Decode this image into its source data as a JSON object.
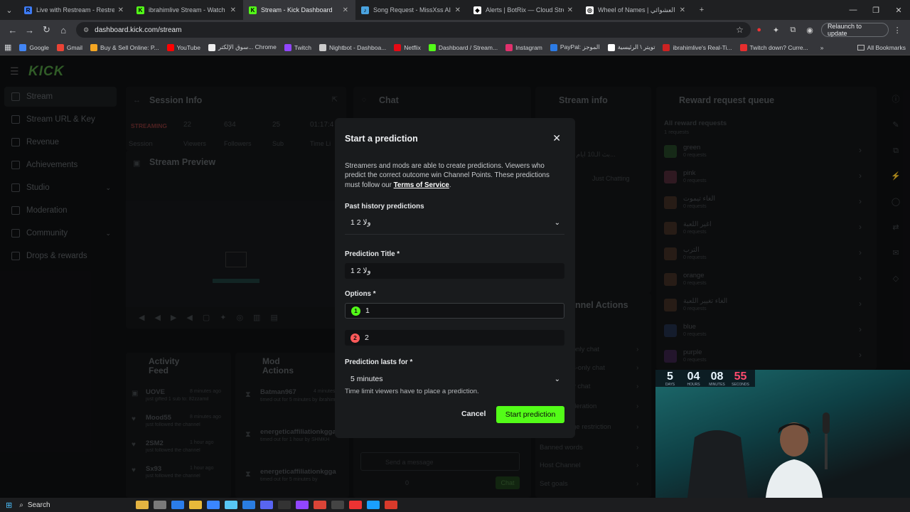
{
  "browser": {
    "tabs": [
      {
        "label": "Live with Restream - Restream",
        "color": "#3d7bf5",
        "glyph": "R"
      },
      {
        "label": "ibrahimlive Stream - Watch Live",
        "color": "#53fc18",
        "glyph": "K"
      },
      {
        "label": "Stream - Kick Dashboard",
        "color": "#53fc18",
        "glyph": "K"
      },
      {
        "label": "Song Request - MissXss AI Bot",
        "color": "#4aa3df",
        "glyph": "♪"
      },
      {
        "label": "Alerts | BotRix — Cloud Stream",
        "color": "#ffffff",
        "glyph": "◆"
      },
      {
        "label": "Wheel of Names | اسم العشوائي",
        "color": "#ffffff",
        "glyph": "◎"
      }
    ],
    "url": "dashboard.kick.com/stream",
    "relaunch_label": "Relaunch to update",
    "bookmarks": [
      {
        "label": "Google",
        "color": "#4285f4"
      },
      {
        "label": "Gmail",
        "color": "#ea4335"
      },
      {
        "label": "Buy & Sell Online: P...",
        "color": "#f5a623"
      },
      {
        "label": "YouTube",
        "color": "#ff0000"
      },
      {
        "label": "سوق الإلكتر... Chrome",
        "color": "#eeeeee"
      },
      {
        "label": "Twitch",
        "color": "#9146ff"
      },
      {
        "label": "Nightbot - Dashboa...",
        "color": "#cccccc"
      },
      {
        "label": "Netflix",
        "color": "#e50914"
      },
      {
        "label": "Dashboard / Stream...",
        "color": "#53fc18"
      },
      {
        "label": "Instagram",
        "color": "#e1306c"
      },
      {
        "label": "PayPal: الموجز",
        "color": "#2c7be5"
      },
      {
        "label": "تويتر \\ الرئيسية",
        "color": "#ffffff"
      },
      {
        "label": "ibrahimlive's Real-Ti...",
        "color": "#c22"
      },
      {
        "label": "Twitch down? Curre...",
        "color": "#e62e2e"
      }
    ],
    "all_bookmarks_label": "All Bookmarks"
  },
  "kick": {
    "logo": "KICK",
    "sidebar": [
      {
        "label": "Stream",
        "active": true,
        "chev": false
      },
      {
        "label": "Stream URL & Key",
        "active": false,
        "chev": false
      },
      {
        "label": "Revenue",
        "active": false,
        "chev": false
      },
      {
        "label": "Achievements",
        "active": false,
        "chev": false
      },
      {
        "label": "Studio",
        "active": false,
        "chev": true
      },
      {
        "label": "Moderation",
        "active": false,
        "chev": false
      },
      {
        "label": "Community",
        "active": false,
        "chev": true
      },
      {
        "label": "Drops & rewards",
        "active": false,
        "chev": false
      }
    ],
    "session": {
      "title": "Session Info",
      "status": "STREAMING",
      "status_sub": "Session",
      "stats": [
        {
          "value": "22",
          "label": "Viewers"
        },
        {
          "value": "634",
          "label": "Followers"
        },
        {
          "value": "25",
          "label": "Sub"
        },
        {
          "value": "01:17:4",
          "label": "Time Li"
        }
      ]
    },
    "preview_title": "Stream Preview",
    "chat_title": "Chat",
    "chat_input": "Send a message",
    "chat_count": "0",
    "chat_btn": "Chat",
    "stream_info": {
      "title": "Stream info",
      "stream_title": "بث الـ10 ايام | اللهم صل و...",
      "category": "Just Chatting"
    },
    "channel_actions": {
      "title": "nnel Actions",
      "items": [
        "only chat",
        "s-only chat",
        "y chat",
        "deration",
        "ge restriction",
        "Banned words",
        "Host Channel",
        "Set goals"
      ]
    },
    "reward_queue": {
      "title": "Reward request queue",
      "subtitle": "All reward requests",
      "subcount": "1 requests",
      "items": [
        {
          "label": "green",
          "count": "0 requests",
          "color": "#3f8f3f"
        },
        {
          "label": "pink",
          "count": "0 requests",
          "color": "#b04a6a"
        },
        {
          "label": "الغاء تيموت",
          "count": "0 requests",
          "color": "#8a5a3a"
        },
        {
          "label": "اغير اللعبة",
          "count": "0 requests",
          "color": "#8a5a3a"
        },
        {
          "label": "الترب",
          "count": "0 requests",
          "color": "#8a5a3a"
        },
        {
          "label": "orange",
          "count": "0 requests",
          "color": "#8a5a3a"
        },
        {
          "label": "الغاء تغيير اللعبة",
          "count": "0 requests",
          "color": "#8a5a3a"
        },
        {
          "label": "blue",
          "count": "0 requests",
          "color": "#3a5a9a"
        },
        {
          "label": "purple",
          "count": "0 requests",
          "color": "#7a3a9a"
        }
      ]
    },
    "activity": {
      "title": "Activity Feed",
      "items": [
        {
          "user": "UOVE",
          "time": "8 minutes ago",
          "text": "just gifted 1 sub to: 82zzamil"
        },
        {
          "user": "Mood55",
          "time": "8 minutes ago",
          "text": "just followed the channel"
        },
        {
          "user": "2SM2",
          "time": "1 hour ago",
          "text": "just followed the channel"
        },
        {
          "user": "Sx93",
          "time": "1 hour ago",
          "text": "just followed the channel"
        }
      ]
    },
    "mod_actions": {
      "title": "Mod Actions",
      "items": [
        {
          "user": "Batman967",
          "time": "4 minutes ago",
          "text": "timed out for 5 minutes by ibrahimlive"
        },
        {
          "user": "energeticaffiliationkgga",
          "time": "",
          "text": "timed out for 1 hour by SHMKH"
        },
        {
          "user": "energeticaffiliationkgga",
          "time": "",
          "text": "timed out for 5 minutes by"
        }
      ]
    }
  },
  "modal": {
    "title": "Start a prediction",
    "desc_text": "Streamers and mods are able to create predictions. Viewers who predict the correct outcome win Channel Points. These predictions must follow our ",
    "desc_link": "Terms of Service",
    "desc_end": ".",
    "history_label": "Past history predictions",
    "history_value": "ولا 2 1",
    "title_label": "Prediction Title *",
    "title_value": "ولا 2 1",
    "options_label": "Options *",
    "options": [
      {
        "num": "1",
        "value": "1",
        "color": "#53fc18"
      },
      {
        "num": "2",
        "value": "2",
        "color": "#ff5a5a"
      }
    ],
    "duration_label": "Prediction lasts for *",
    "duration_value": "5 minutes",
    "duration_hint": "Time limit viewers have to place a prediction.",
    "cancel_label": "Cancel",
    "start_label": "Start prediction"
  },
  "timer": {
    "blocks": [
      {
        "value": "5",
        "unit": "DAYS"
      },
      {
        "value": "04",
        "unit": "HOURS"
      },
      {
        "value": "08",
        "unit": "MINUTES"
      },
      {
        "value": "55",
        "unit": "SECONDS"
      }
    ]
  },
  "taskbar": {
    "search_label": "Search"
  },
  "colors": {
    "brand": "#53fc18",
    "bg": "#0f1012",
    "modal": "#191b1d"
  }
}
